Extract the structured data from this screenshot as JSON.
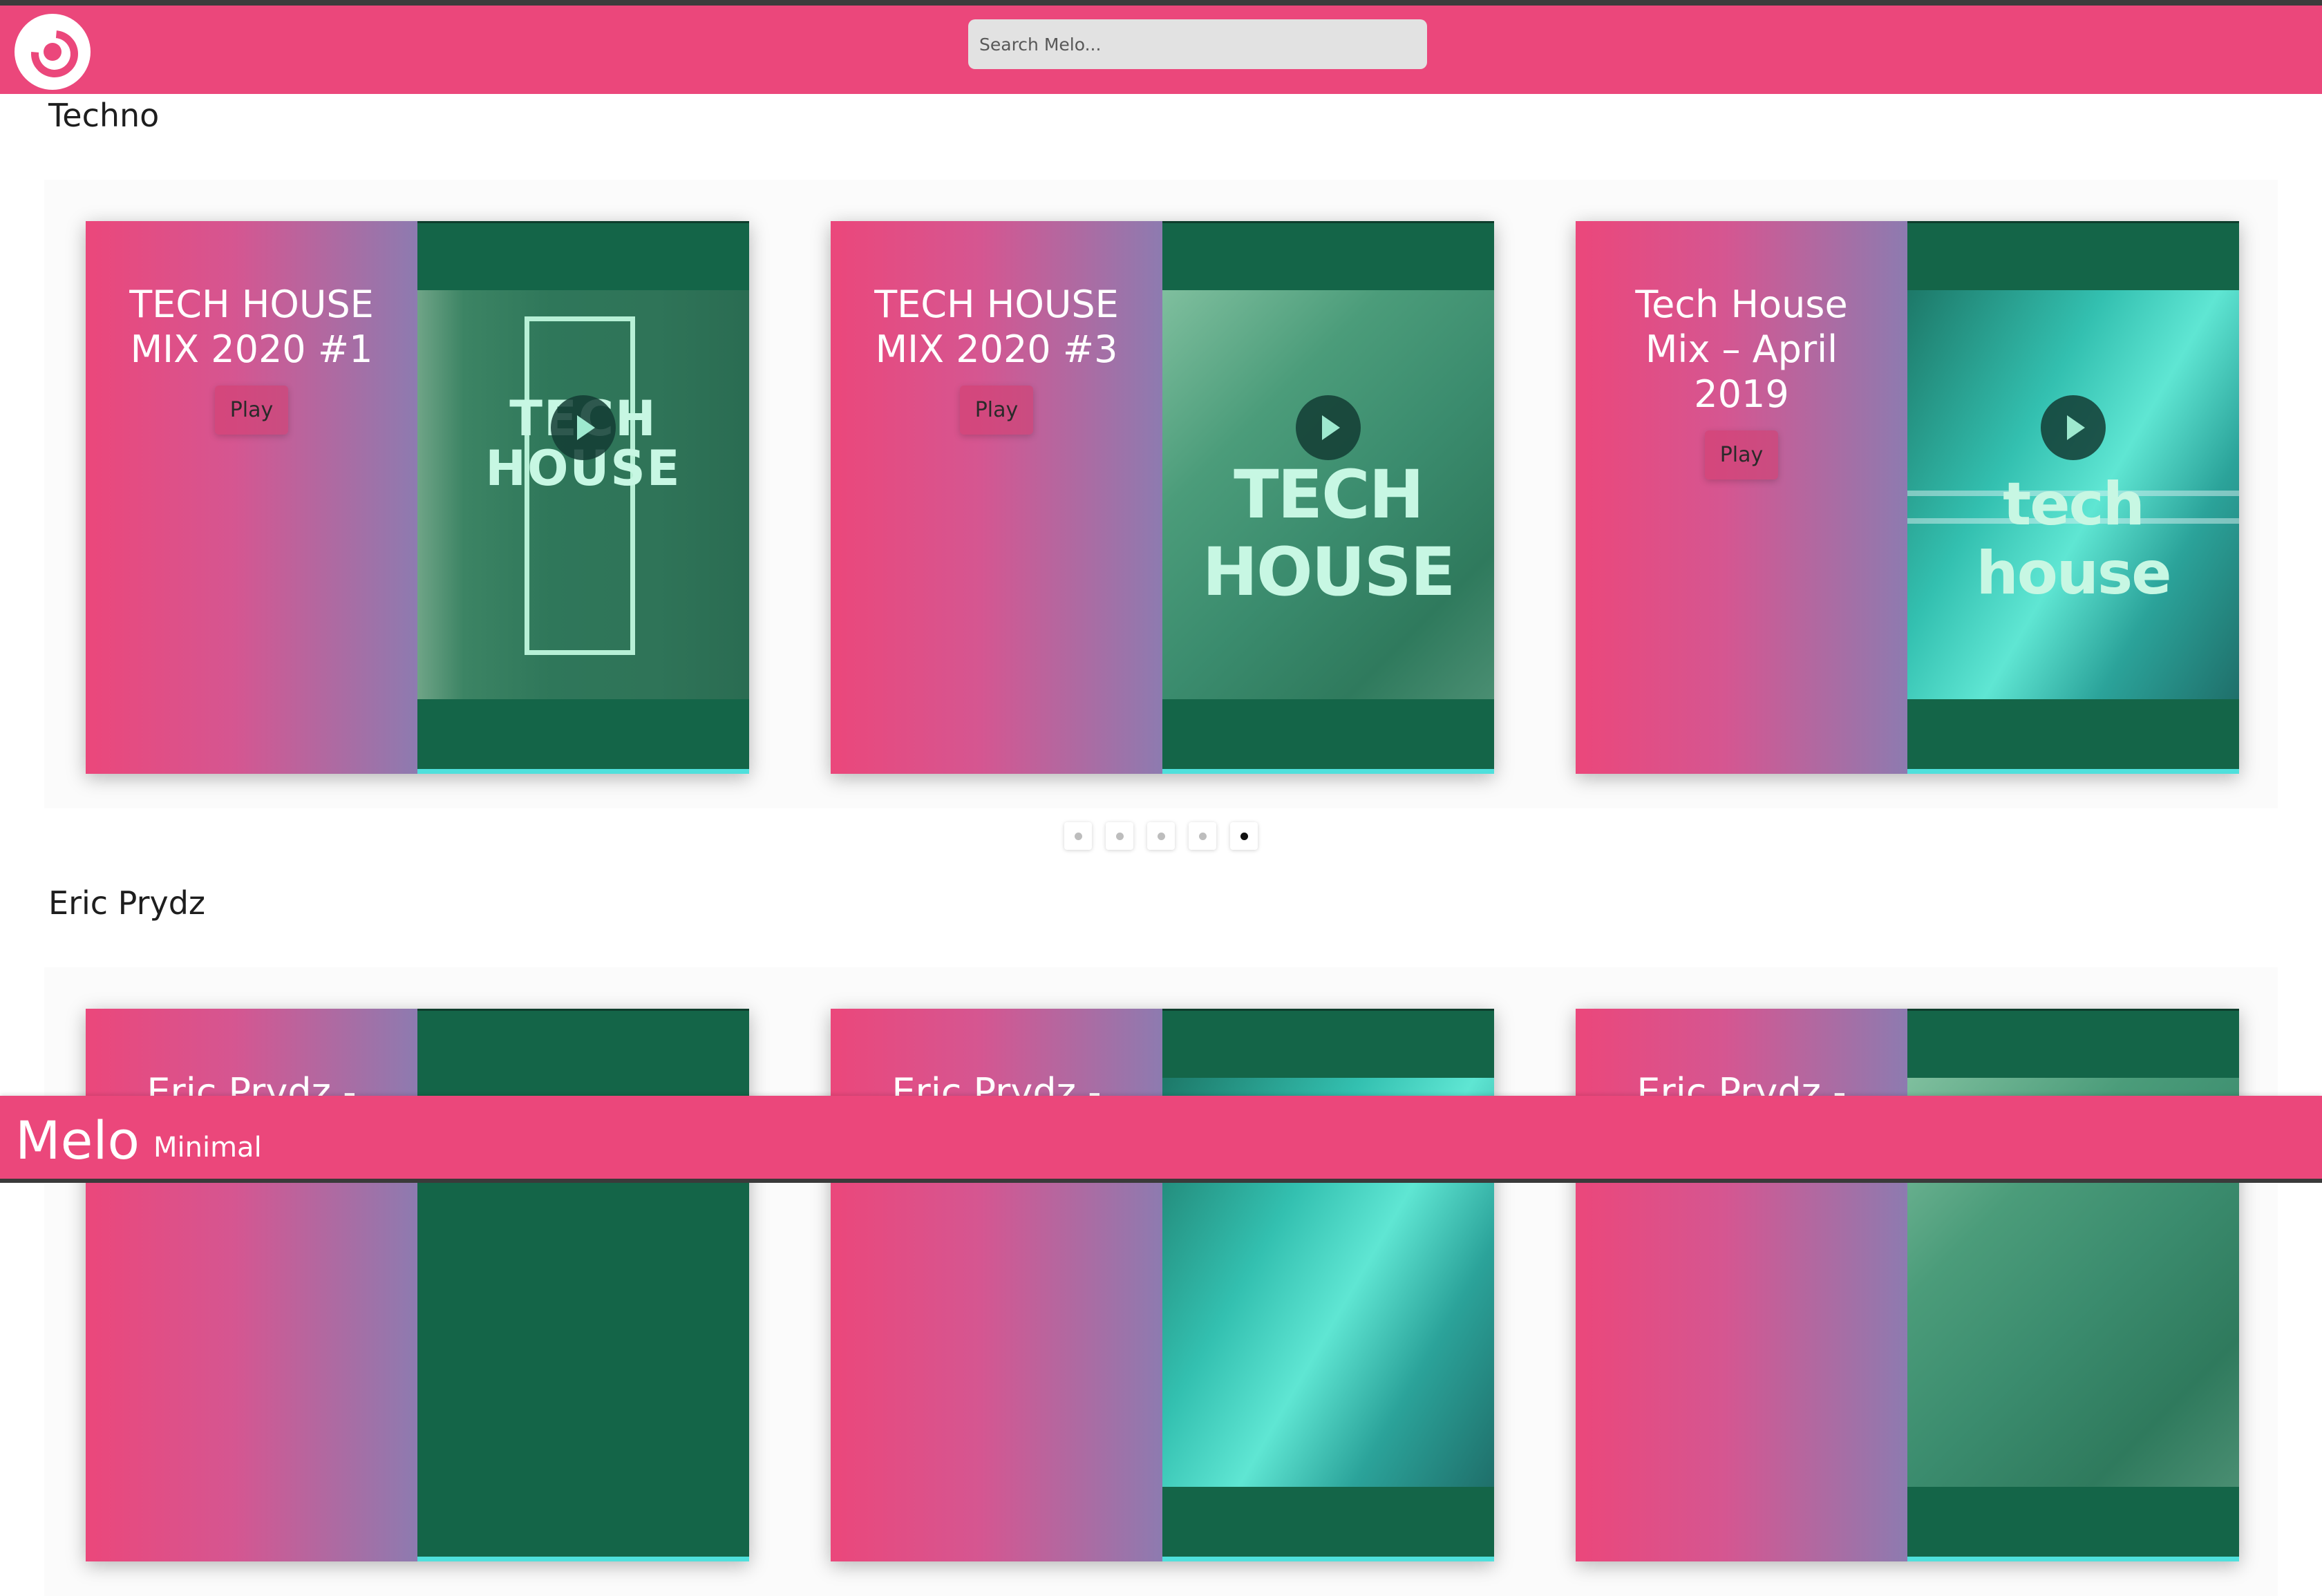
{
  "header": {
    "logo_name": "vinyl-logo",
    "search": {
      "placeholder": "Search Melo...",
      "value": ""
    }
  },
  "sections": [
    {
      "title": "Techno",
      "cards": [
        {
          "title": "TECH HOUSE MIX 2020 #1",
          "play_label": "Play",
          "art_text": "TECH HOUSE"
        },
        {
          "title": "TECH HOUSE MIX 2020 #3",
          "play_label": "Play",
          "art_text": "TECH HOUSE"
        },
        {
          "title": "Tech House Mix – April 2019",
          "play_label": "Play",
          "art_text": "tech house"
        }
      ],
      "pagination": {
        "count": 5,
        "active_index": 5
      }
    },
    {
      "title": "Eric Prydz",
      "cards": [
        {
          "title": "Eric Prydz -"
        },
        {
          "title": "Eric Prydz -"
        },
        {
          "title": "Eric Prydz -"
        }
      ]
    }
  ],
  "footer": {
    "brand": "Melo",
    "tagline": "Minimal"
  },
  "colors": {
    "accent": "#eb477b",
    "card_art_bg": "#146548",
    "gradient_end": "#8d7bb0"
  }
}
